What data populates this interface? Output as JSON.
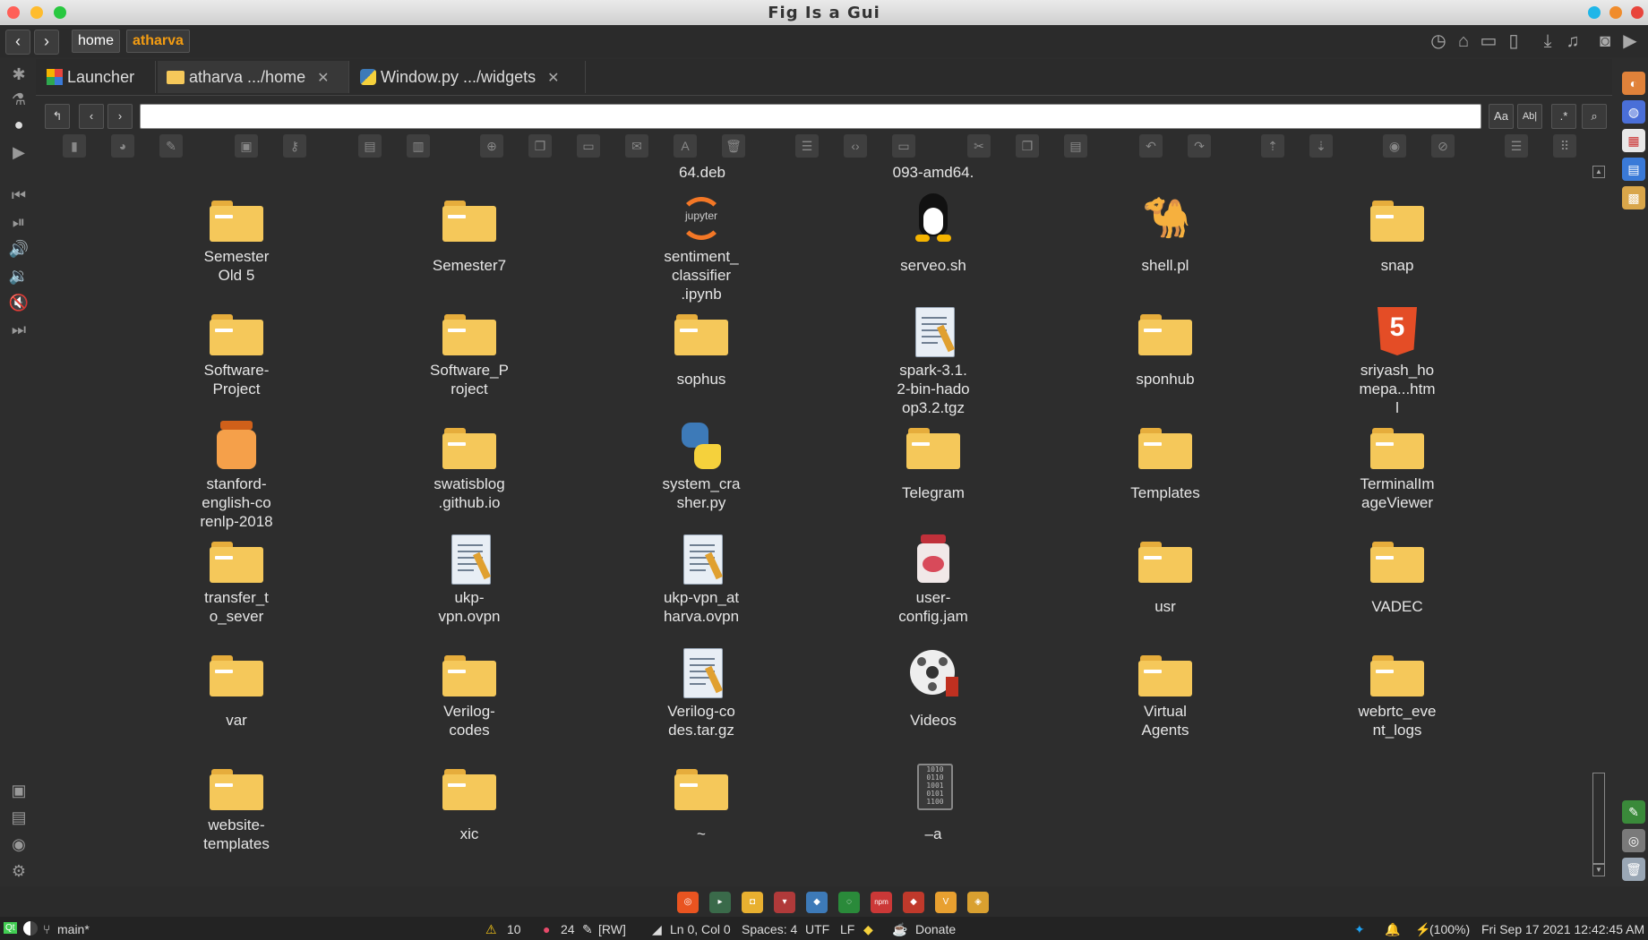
{
  "window": {
    "title": "Fig Is a Gui"
  },
  "breadcrumb": {
    "home": "home",
    "current": "atharva"
  },
  "tabs": [
    {
      "label": "Launcher"
    },
    {
      "label": "atharva .../home"
    },
    {
      "label": "Window.py .../widgets"
    }
  ],
  "search_options": {
    "case": "Aa",
    "word": "Ab|",
    "regex": ".*"
  },
  "partial_top": [
    "64.deb",
    "093-amd64."
  ],
  "files": [
    {
      "label": "Semester\nOld 5",
      "icon": "folder-icon"
    },
    {
      "label": "Semester7",
      "icon": "folder-icon"
    },
    {
      "label": "sentiment_\nclassifier\n.ipynb",
      "icon": "jupyter-icon"
    },
    {
      "label": "serveo.sh",
      "icon": "linux-penguin-icon"
    },
    {
      "label": "shell.pl",
      "icon": "perl-camel-icon"
    },
    {
      "label": "snap",
      "icon": "folder-icon"
    },
    {
      "label": "Software-\nProject",
      "icon": "folder-icon"
    },
    {
      "label": "Software_P\nroject",
      "icon": "folder-icon"
    },
    {
      "label": "sophus",
      "icon": "folder-icon"
    },
    {
      "label": "spark-3.1.\n2-bin-hado\nop3.2.tgz",
      "icon": "archive-doc-icon"
    },
    {
      "label": "sponhub",
      "icon": "folder-icon"
    },
    {
      "label": "sriyash_ho\nmepa...htm\nl",
      "icon": "html5-icon"
    },
    {
      "label": "stanford-\nenglish-co\nrenlp-2018",
      "icon": "jar-icon"
    },
    {
      "label": "swatisblog\n.github.io",
      "icon": "folder-icon"
    },
    {
      "label": "system_cra\nsher.py",
      "icon": "python-icon"
    },
    {
      "label": "Telegram",
      "icon": "folder-icon"
    },
    {
      "label": "Templates",
      "icon": "folder-icon"
    },
    {
      "label": "TerminalIm\nageViewer",
      "icon": "folder-icon"
    },
    {
      "label": "transfer_t\no_sever",
      "icon": "folder-icon"
    },
    {
      "label": "ukp-\nvpn.ovpn",
      "icon": "text-doc-icon"
    },
    {
      "label": "ukp-vpn_at\nharva.ovpn",
      "icon": "text-doc-icon"
    },
    {
      "label": "user-\nconfig.jam",
      "icon": "jam-jar-icon"
    },
    {
      "label": "usr",
      "icon": "folder-icon"
    },
    {
      "label": "VADEC",
      "icon": "folder-icon"
    },
    {
      "label": "var",
      "icon": "folder-icon"
    },
    {
      "label": "Verilog-\ncodes",
      "icon": "folder-icon"
    },
    {
      "label": "Verilog-co\ndes.tar.gz",
      "icon": "archive-doc-icon"
    },
    {
      "label": "Videos",
      "icon": "film-reel-icon"
    },
    {
      "label": "Virtual\nAgents",
      "icon": "folder-icon"
    },
    {
      "label": "webrtc_eve\nnt_logs",
      "icon": "folder-icon"
    },
    {
      "label": "website-\ntemplates",
      "icon": "folder-icon"
    },
    {
      "label": "xic",
      "icon": "folder-icon"
    },
    {
      "label": "~",
      "icon": "folder-icon"
    },
    {
      "label": "–a",
      "icon": "binary-file-icon"
    }
  ],
  "status": {
    "branch": "main*",
    "warnings": "10",
    "errors": "24",
    "mode": "[RW]",
    "position": "Ln 0, Col 0",
    "spaces": "Spaces: 4",
    "encoding": "UTF",
    "eol": "LF",
    "donate": "Donate",
    "battery": "(100%)",
    "clock": "Fri Sep 17 2021 12:42:45 AM"
  },
  "colors": {
    "accent": "#f39c12",
    "folder": "#f5c85a",
    "background": "#2d2d2d"
  }
}
